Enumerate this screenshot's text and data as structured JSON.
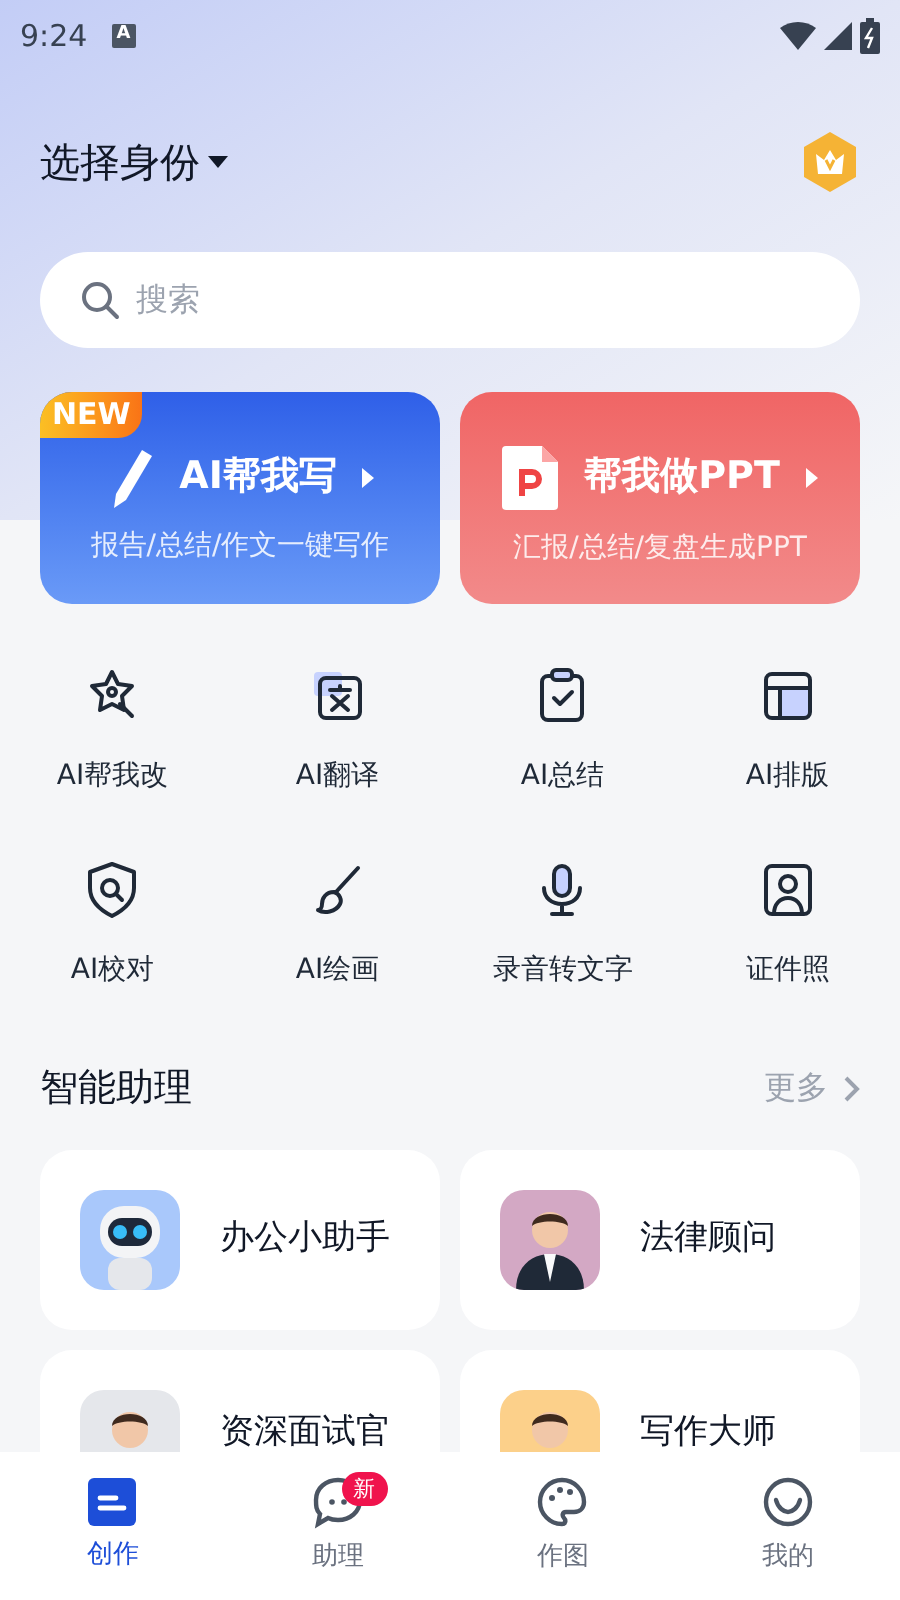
{
  "status_bar": {
    "time": "9:24",
    "notification": "A"
  },
  "header": {
    "title": "选择身份"
  },
  "search": {
    "placeholder": "搜索"
  },
  "feature_cards": [
    {
      "kind": "write",
      "badge": "NEW",
      "title": "AI帮我写",
      "subtitle": "报告/总结/作文一键写作"
    },
    {
      "kind": "ppt",
      "title": "帮我做PPT",
      "subtitle": "汇报/总结/复盘生成PPT"
    }
  ],
  "tools": [
    {
      "kind": "rewrite",
      "label": "AI帮我改"
    },
    {
      "kind": "translate",
      "label": "AI翻译"
    },
    {
      "kind": "summary",
      "label": "AI总结"
    },
    {
      "kind": "layout",
      "label": "AI排版"
    },
    {
      "kind": "proofread",
      "label": "AI校对"
    },
    {
      "kind": "paint",
      "label": "AI绘画"
    },
    {
      "kind": "voice",
      "label": "录音转文字"
    },
    {
      "kind": "idphoto",
      "label": "证件照"
    }
  ],
  "assistants_section": {
    "title": "智能助理",
    "more": "更多"
  },
  "assistants": [
    {
      "kind": "robot",
      "name": "办公小助手"
    },
    {
      "kind": "person",
      "name": "法律顾问"
    },
    {
      "kind": "person",
      "name": "资深面试官"
    },
    {
      "kind": "person",
      "name": "写作大师"
    }
  ],
  "bottom_nav": [
    {
      "kind": "create",
      "label": "创作",
      "selected": true
    },
    {
      "kind": "chat",
      "label": "助理",
      "selected": false,
      "badge": "新"
    },
    {
      "kind": "palette",
      "label": "作图",
      "selected": false
    },
    {
      "kind": "smile",
      "label": "我的",
      "selected": false
    }
  ]
}
